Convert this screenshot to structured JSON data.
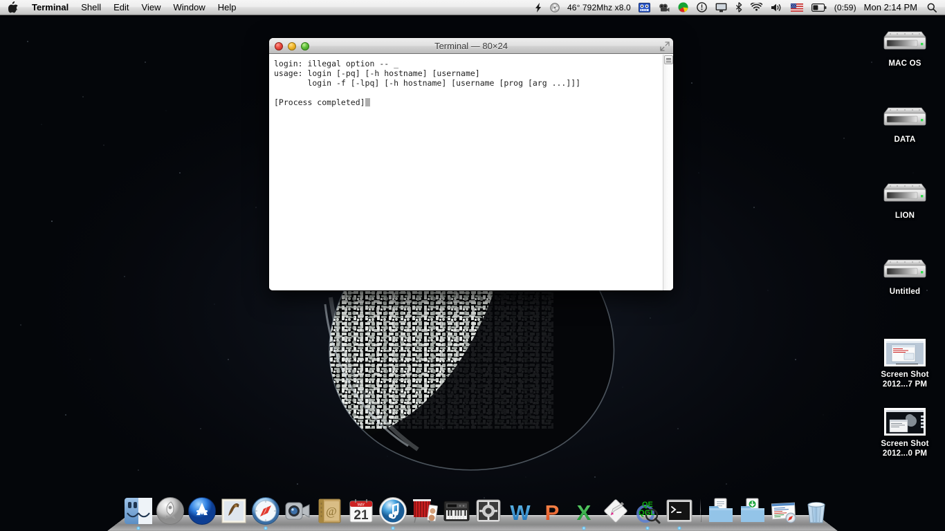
{
  "menubar": {
    "apple_logo": "apple-logo",
    "items": [
      {
        "label": "Terminal",
        "bold": true
      },
      {
        "label": "Shell",
        "bold": false
      },
      {
        "label": "Edit",
        "bold": false
      },
      {
        "label": "View",
        "bold": false
      },
      {
        "label": "Window",
        "bold": false
      },
      {
        "label": "Help",
        "bold": false
      }
    ],
    "extras": [
      {
        "name": "bolt-icon"
      },
      {
        "name": "fan-speed-icon"
      },
      {
        "name": "istat-temp-text",
        "text": "46° 792Mhz x8.0"
      },
      {
        "name": "vlc-cone-icon"
      },
      {
        "name": "camera-icon"
      },
      {
        "name": "disk-pie-icon"
      },
      {
        "name": "clock-alert-icon"
      },
      {
        "name": "display-icon"
      },
      {
        "name": "bluetooth-icon"
      },
      {
        "name": "wifi-icon"
      },
      {
        "name": "volume-icon"
      },
      {
        "name": "us-flag-icon"
      },
      {
        "name": "battery-icon"
      }
    ],
    "battery_time": "(0:59)",
    "clock": "Mon 2:14 PM",
    "spotlight": "search-icon"
  },
  "terminal": {
    "title": "Terminal — 80×24",
    "traffic_lights": [
      "close",
      "minimize",
      "zoom"
    ],
    "resize_icon": "fullscreen-icon",
    "lines": [
      "login: illegal option -- _",
      "usage: login [-pq] [-h hostname] [username]",
      "       login -f [-lpq] [-h hostname] [username [prog [arg ...]]]",
      "",
      "[Process completed]"
    ],
    "cursor": "block-cursor"
  },
  "desktop_icons": [
    {
      "name": "MAC OS",
      "type": "hard-drive",
      "label": "MAC OS"
    },
    {
      "name": "DATA",
      "type": "hard-drive",
      "label": "DATA"
    },
    {
      "name": "LION",
      "type": "hard-drive",
      "label": "LION"
    },
    {
      "name": "Untitled",
      "type": "hard-drive",
      "label": "Untitled"
    },
    {
      "name": "Screen Shot 1",
      "type": "screenshot-thumb",
      "label": "Screen Shot\n2012...7 PM"
    },
    {
      "name": "Screen Shot 2",
      "type": "screenshot-thumb",
      "label": "Screen Shot\n2012...0 PM"
    }
  ],
  "dock": {
    "items": [
      {
        "name": "finder",
        "label": "Finder",
        "running": true
      },
      {
        "name": "launchpad",
        "label": "Launchpad",
        "running": false
      },
      {
        "name": "app-store",
        "label": "App Store",
        "running": false
      },
      {
        "name": "mail",
        "label": "Mail",
        "running": false
      },
      {
        "name": "safari",
        "label": "Safari",
        "running": true
      },
      {
        "name": "facetime",
        "label": "FaceTime",
        "running": false
      },
      {
        "name": "address-book",
        "label": "Address Book",
        "running": false
      },
      {
        "name": "ical",
        "label": "iCal",
        "running": false
      },
      {
        "name": "itunes",
        "label": "iTunes",
        "running": true
      },
      {
        "name": "photo-booth",
        "label": "Photo Booth",
        "running": false
      },
      {
        "name": "garageband",
        "label": "GarageBand",
        "running": false
      },
      {
        "name": "system-preferences",
        "label": "System Preferences",
        "running": false
      },
      {
        "name": "microsoft-word",
        "label": "Microsoft Word",
        "running": false
      },
      {
        "name": "powerpoint",
        "label": "PowerPoint",
        "running": false
      },
      {
        "name": "excel",
        "label": "Excel",
        "running": true
      },
      {
        "name": "sketch-tool",
        "label": "Sketch",
        "running": false
      },
      {
        "name": "qe-qgl",
        "label": "QE/QGL",
        "running": true
      },
      {
        "name": "terminal",
        "label": "Terminal",
        "running": true
      }
    ],
    "stacks": [
      {
        "name": "documents-stack",
        "label": "Documents"
      },
      {
        "name": "downloads-stack",
        "label": "Downloads"
      },
      {
        "name": "recent-file",
        "label": "Recent Document"
      },
      {
        "name": "trash",
        "label": "Trash"
      }
    ]
  },
  "colors": {
    "menubar_bg": "#e6e6e6",
    "terminal_bg": "#ffffff",
    "terminal_fg": "#1e1e1e",
    "desktop_bg": "#05070c",
    "accent_green": "#31d158"
  }
}
